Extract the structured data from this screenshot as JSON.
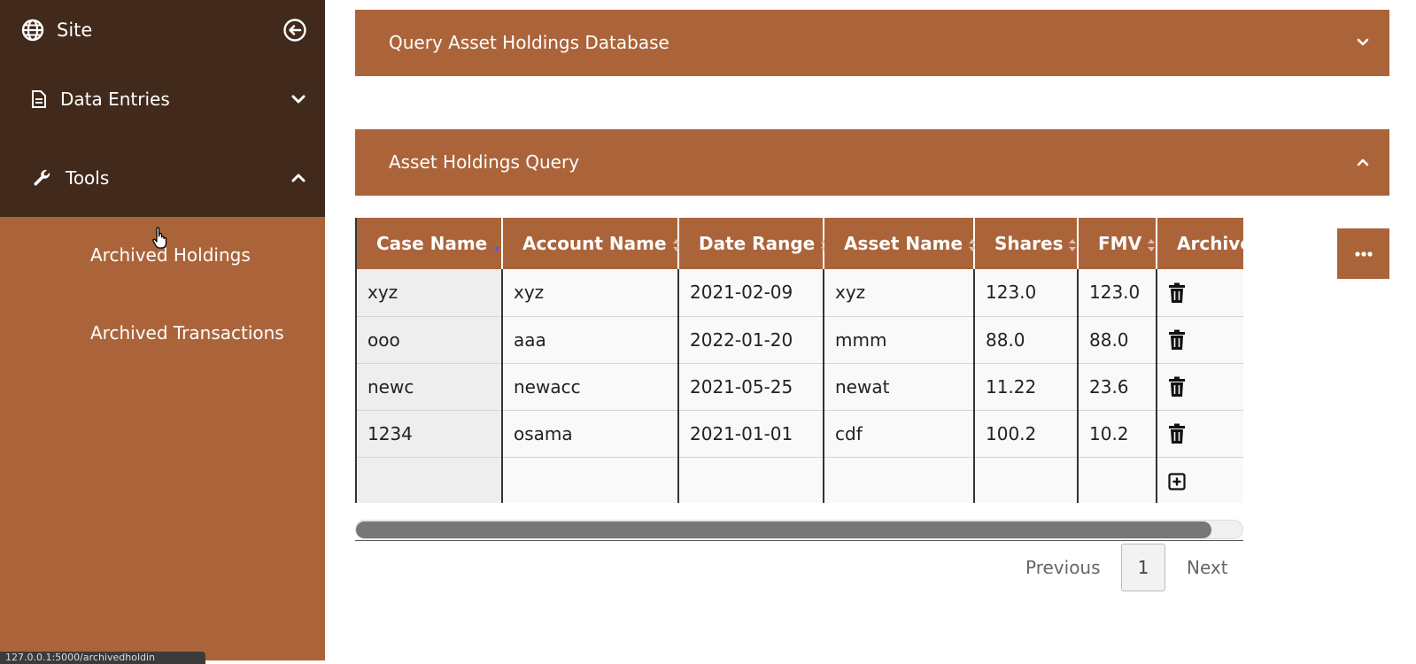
{
  "sidebar": {
    "site_label": "Site",
    "nav": [
      {
        "label": "Data Entries",
        "icon": "document-icon",
        "expanded": false
      },
      {
        "label": "Tools",
        "icon": "wrench-icon",
        "expanded": true
      }
    ],
    "tools_items": [
      "Archived Holdings",
      "Archived Transactions"
    ]
  },
  "status_bar": "127.0.0.1:5000/archivedholdin",
  "panels": {
    "query_db_title": "Query Asset Holdings Database",
    "query_title": "Asset Holdings Query"
  },
  "table": {
    "columns": [
      "Case Name",
      "Account Name",
      "Date Range",
      "Asset Name",
      "Shares",
      "FMV",
      "Archive"
    ],
    "rows": [
      [
        "xyz",
        "xyz",
        "2021-02-09",
        "xyz",
        "123.0",
        "123.0"
      ],
      [
        "ooo",
        "aaa",
        "2022-01-20",
        "mmm",
        "88.0",
        "88.0"
      ],
      [
        "newc",
        "newacc",
        "2021-05-25",
        "newat",
        "11.22",
        "23.6"
      ],
      [
        "1234",
        "osama",
        "2021-01-01",
        "cdf",
        "100.2",
        "10.2"
      ]
    ]
  },
  "pagination": {
    "previous": "Previous",
    "page": "1",
    "next": "Next"
  },
  "colors": {
    "accent": "#ab643a",
    "sidebar_dark": "#412a1c",
    "sort_active": "#5b5bd6"
  }
}
